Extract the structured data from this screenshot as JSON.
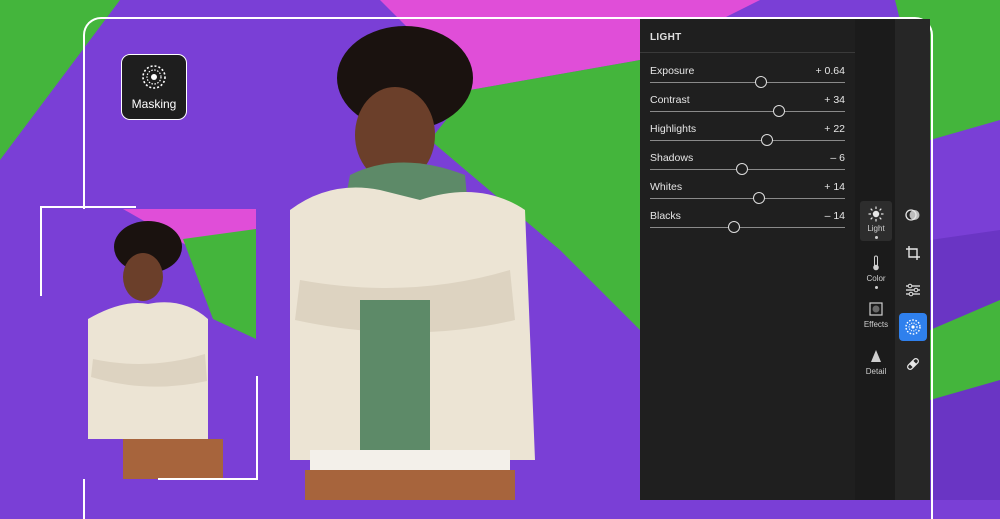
{
  "masking": {
    "label": "Masking",
    "icon": "masking-icon"
  },
  "panel": {
    "title": "LIGHT",
    "sliders": [
      {
        "label": "Exposure",
        "value": "+ 0.64",
        "position": 0.57
      },
      {
        "label": "Contrast",
        "value": "+ 34",
        "position": 0.66
      },
      {
        "label": "Highlights",
        "value": "+ 22",
        "position": 0.6
      },
      {
        "label": "Shadows",
        "value": "– 6",
        "position": 0.47
      },
      {
        "label": "Whites",
        "value": "+ 14",
        "position": 0.56
      },
      {
        "label": "Blacks",
        "value": "– 14",
        "position": 0.43
      }
    ]
  },
  "side_nav": [
    {
      "label": "Light",
      "icon": "sun-icon",
      "active": true
    },
    {
      "label": "Color",
      "icon": "thermometer-icon",
      "active": false
    },
    {
      "label": "Effects",
      "icon": "effects-icon",
      "active": false
    },
    {
      "label": "Detail",
      "icon": "triangle-icon",
      "active": false
    }
  ],
  "tool_rail": [
    {
      "icon": "circles-icon",
      "active": false
    },
    {
      "icon": "crop-icon",
      "active": false
    },
    {
      "icon": "sliders-icon",
      "active": false
    },
    {
      "icon": "masking-icon",
      "active": true
    },
    {
      "icon": "bandage-icon",
      "active": false
    }
  ],
  "colors": {
    "purple": "#7a3fd6",
    "green": "#44b53c",
    "magenta": "#e04ed8",
    "panel": "#1f1f1f",
    "accent": "#2f80ed"
  }
}
